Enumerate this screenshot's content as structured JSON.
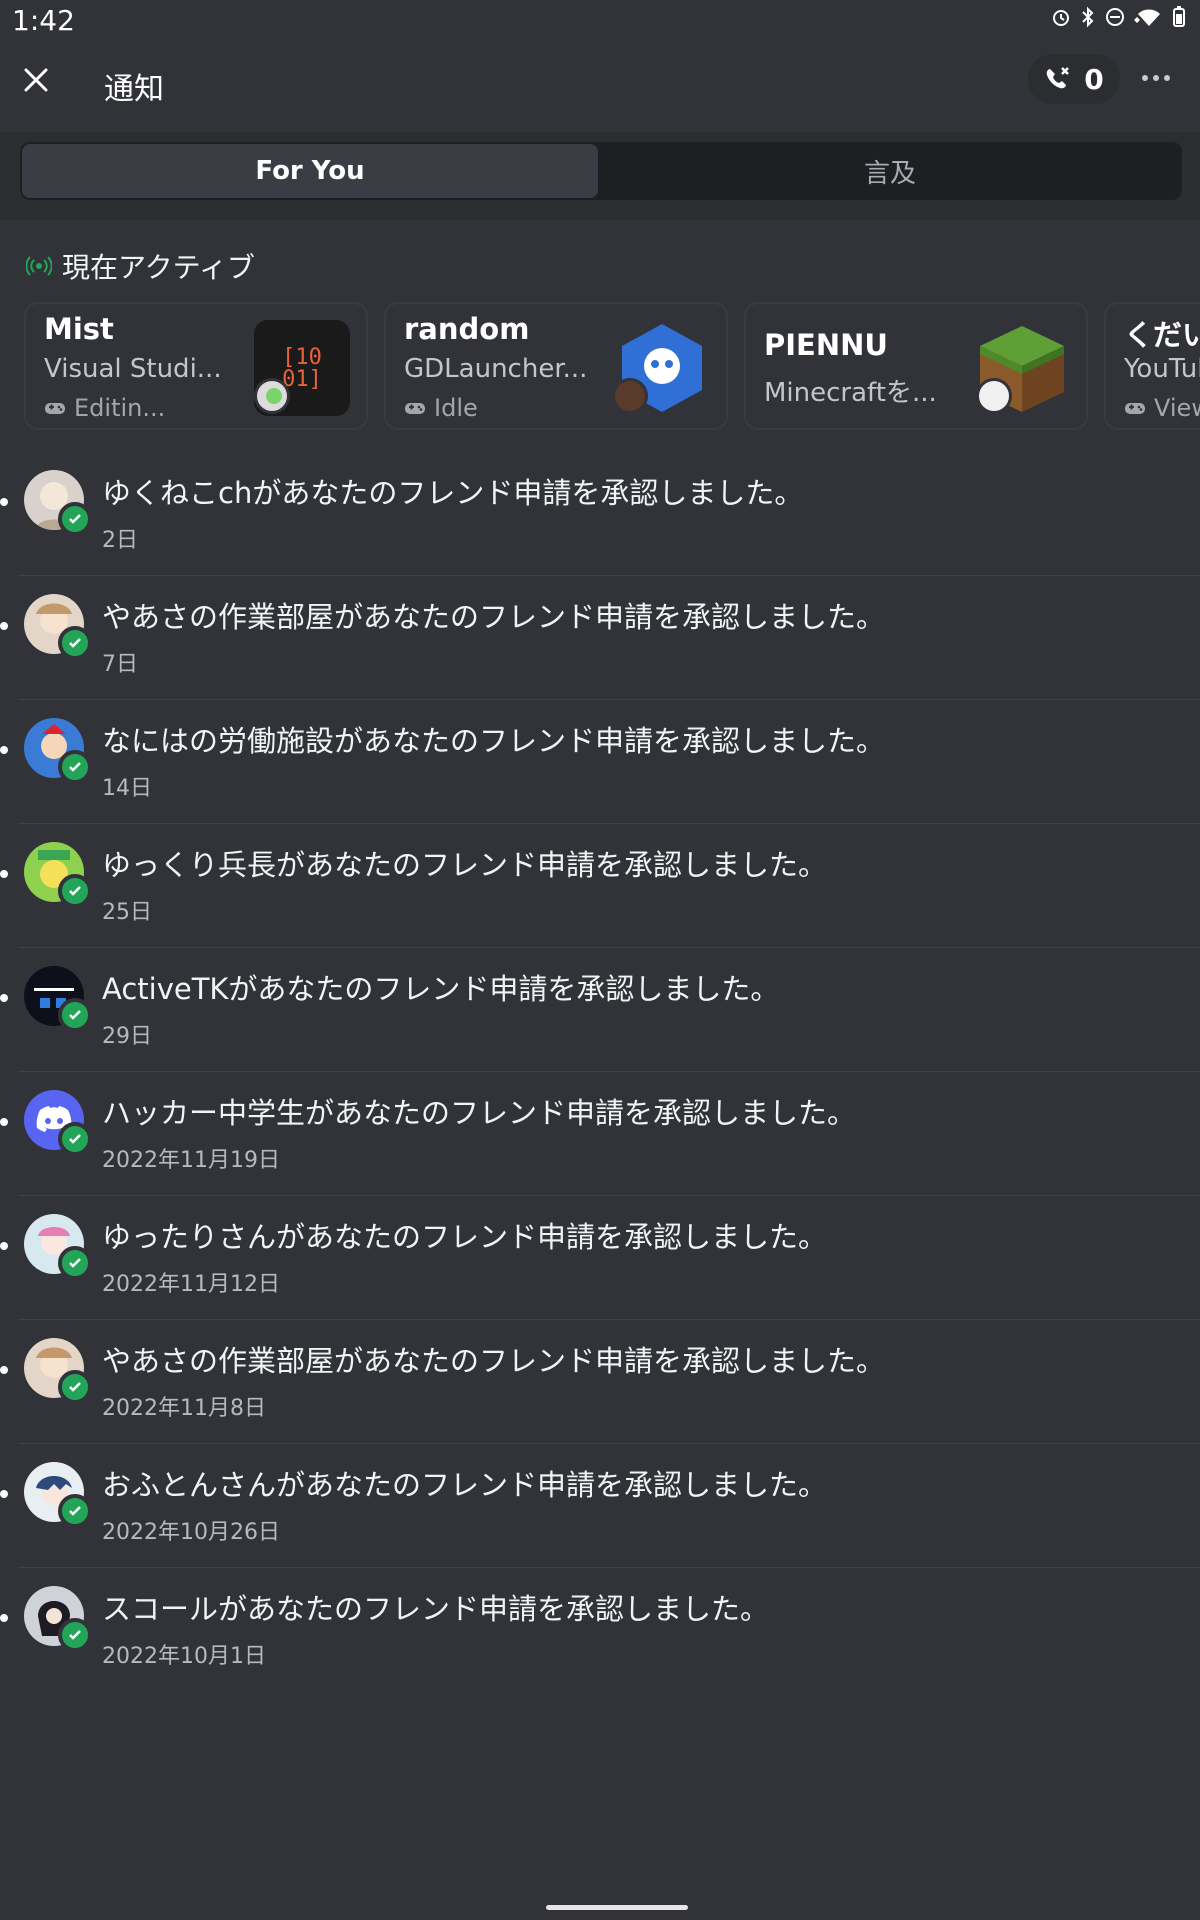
{
  "status_bar": {
    "time": "1:42",
    "icons": [
      "alarm-icon",
      "bluetooth-icon",
      "dnd-icon",
      "wifi-icon",
      "battery-icon"
    ]
  },
  "header": {
    "title": "通知",
    "call_count": "0"
  },
  "tabs": [
    {
      "label": "For You",
      "active": true
    },
    {
      "label": "言及",
      "active": false
    }
  ],
  "active_now": {
    "title": "現在アクティブ",
    "cards": [
      {
        "name": "Mist",
        "activity": "Visual Studi...",
        "detail": "Editin..."
      },
      {
        "name": "random",
        "activity": "GDLauncher...",
        "detail": "Idle"
      },
      {
        "name": "PIENNU",
        "activity": "Minecraftを...",
        "detail": ""
      },
      {
        "name": "くだい",
        "activity": "YouTul",
        "detail": "View"
      }
    ]
  },
  "notifications": [
    {
      "message": "ゆくねこchがあなたのフレンド申請を承認しました。",
      "time": "2日"
    },
    {
      "message": "やあさの作業部屋があなたのフレンド申請を承認しました。",
      "time": "7日"
    },
    {
      "message": "なにはの労働施設があなたのフレンド申請を承認しました。",
      "time": "14日"
    },
    {
      "message": "ゆっくり兵長があなたのフレンド申請を承認しました。",
      "time": "25日"
    },
    {
      "message": "ActiveTKがあなたのフレンド申請を承認しました。",
      "time": "29日"
    },
    {
      "message": "ハッカー中学生があなたのフレンド申請を承認しました。",
      "time": "2022年11月19日"
    },
    {
      "message": "ゆったりさんがあなたのフレンド申請を承認しました。",
      "time": "2022年11月12日"
    },
    {
      "message": "やあさの作業部屋があなたのフレンド申請を承認しました。",
      "time": "2022年11月8日"
    },
    {
      "message": "おふとんさんがあなたのフレンド申請を承認しました。",
      "time": "2022年10月26日"
    },
    {
      "message": "スコールがあなたのフレンド申請を承認しました。",
      "time": "2022年10月1日"
    }
  ],
  "colors": {
    "background": "#313338",
    "tab_bar": "#2b2d31",
    "online_green": "#23a559",
    "blurple": "#5865f2"
  }
}
